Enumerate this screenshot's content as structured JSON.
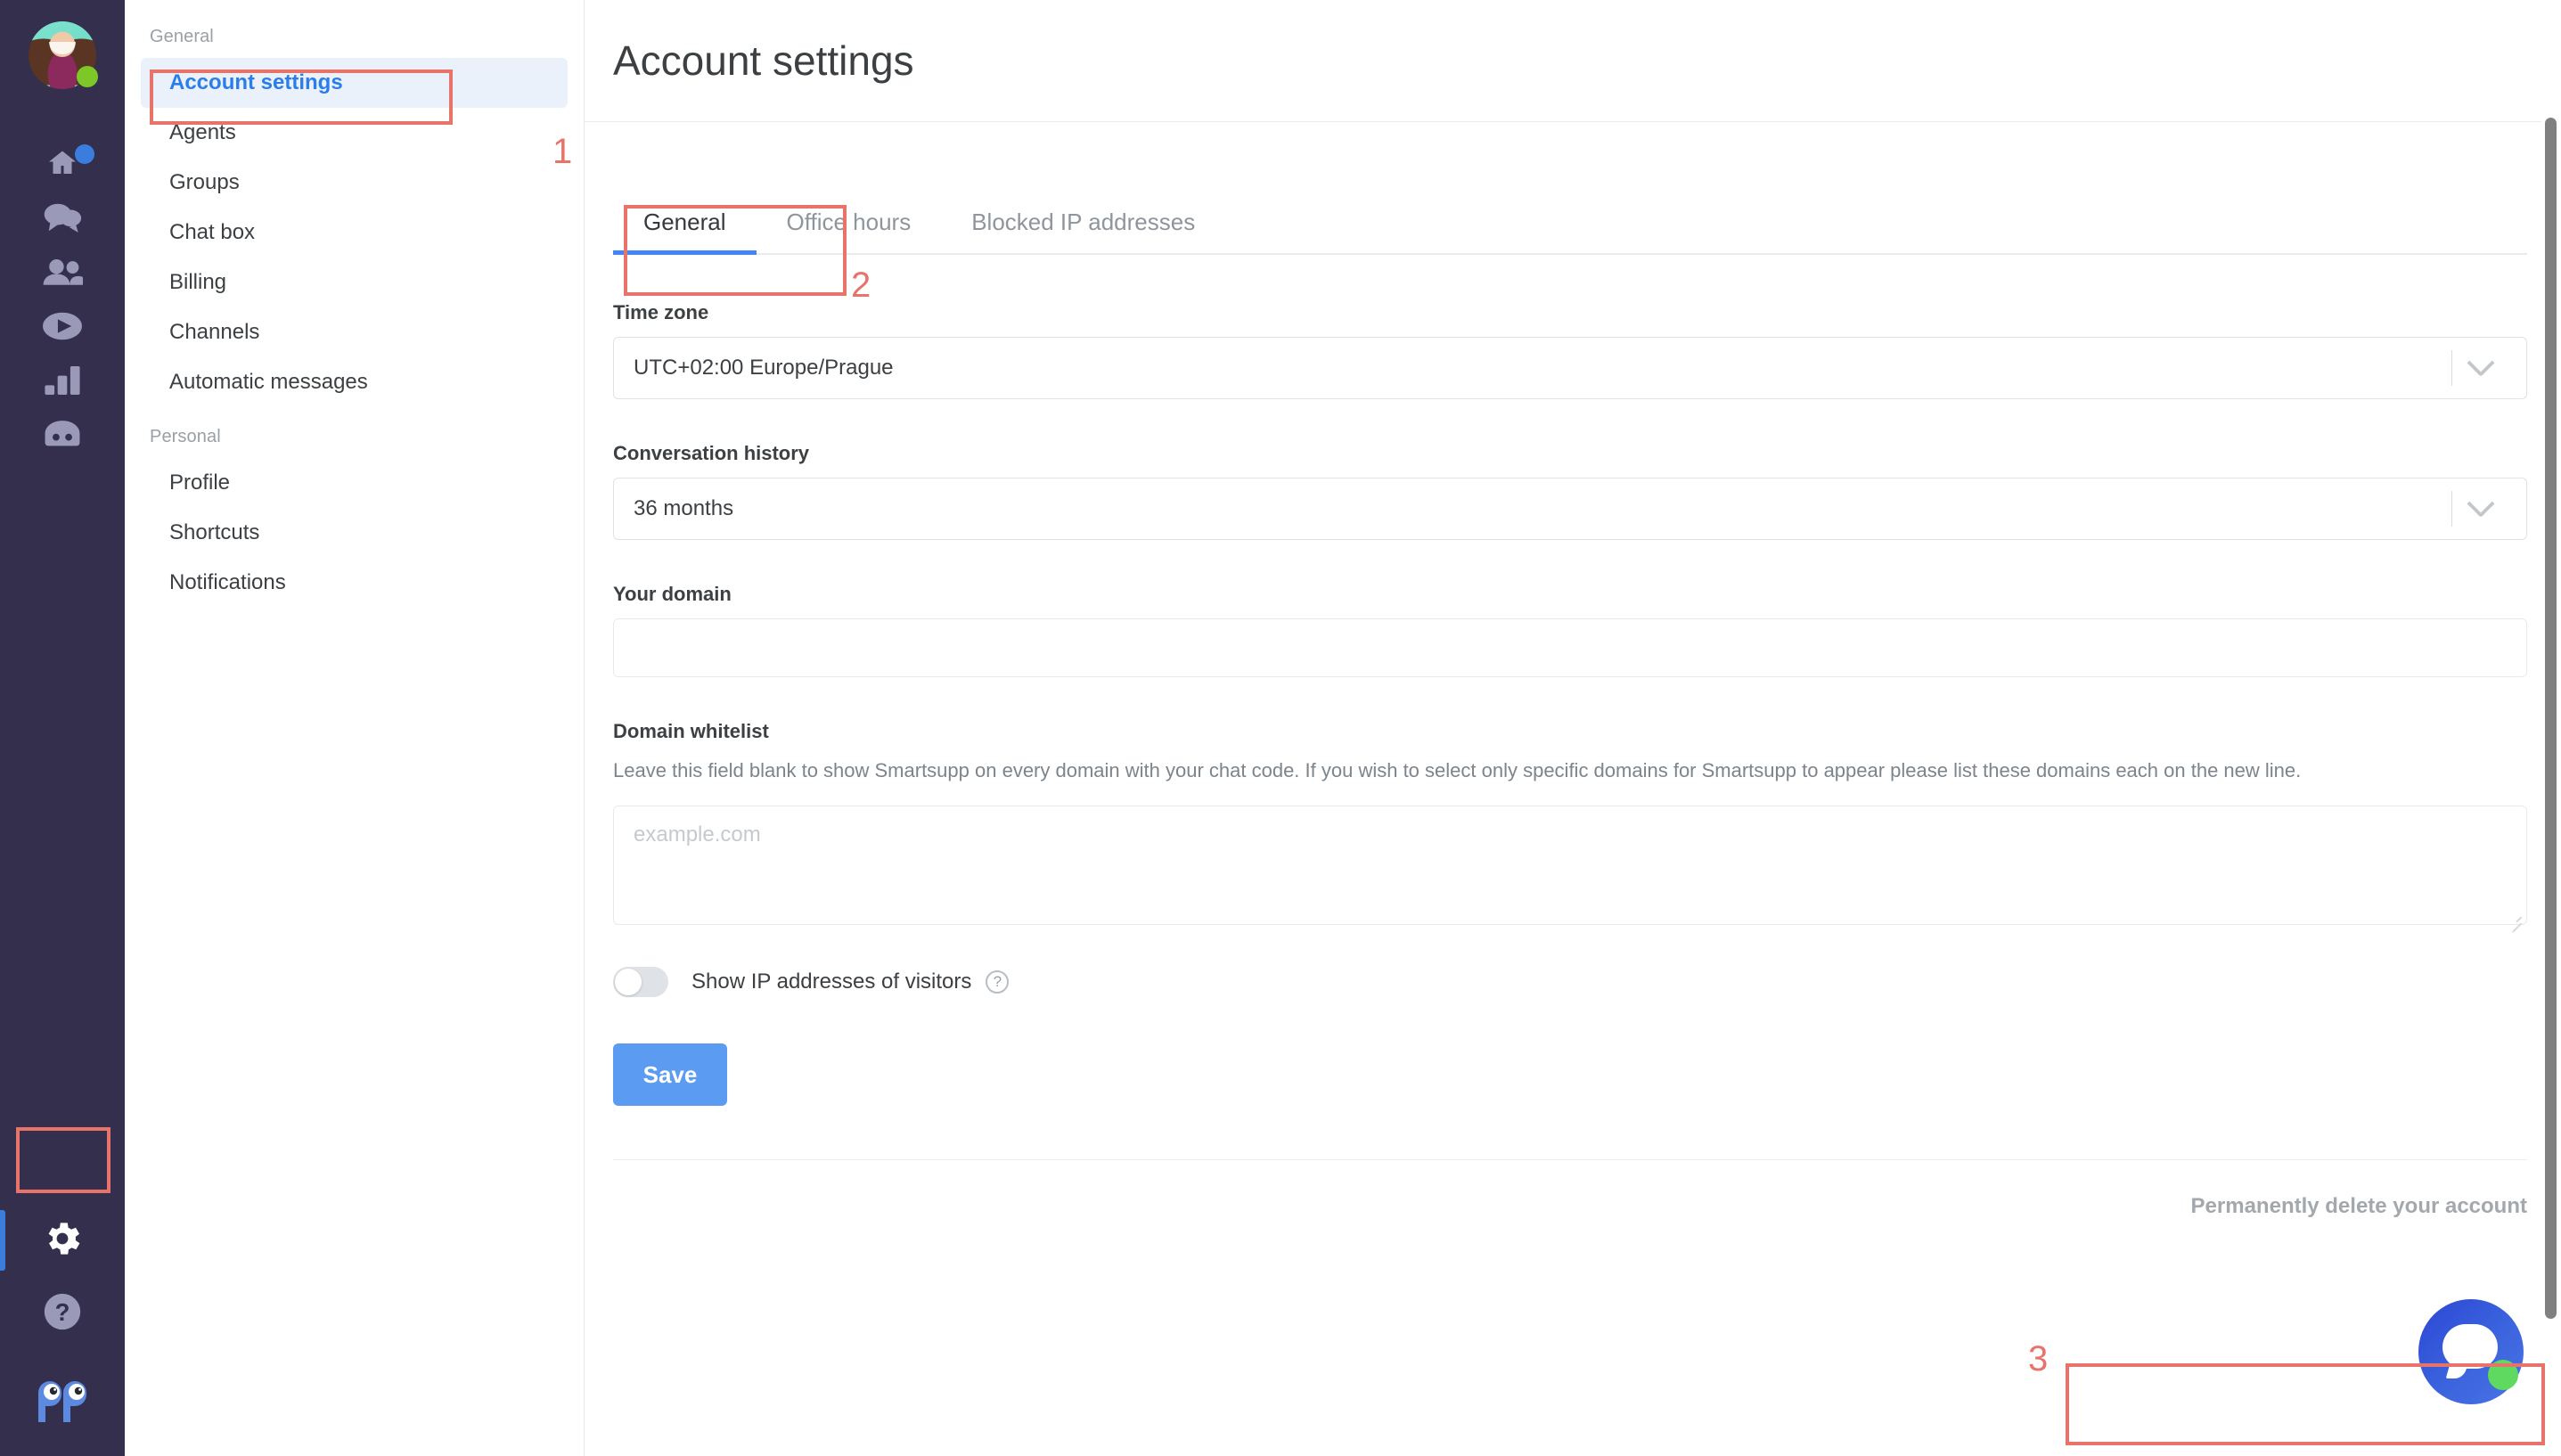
{
  "rail": {
    "avatar": {
      "name": "user-avatar",
      "status": "online"
    },
    "items": [
      {
        "icon": "home-icon",
        "name": "home",
        "badge": true
      },
      {
        "icon": "chat-icon",
        "name": "conversations",
        "badge": false
      },
      {
        "icon": "people-icon",
        "name": "visitors",
        "badge": false
      },
      {
        "icon": "play-icon",
        "name": "recordings",
        "badge": false
      },
      {
        "icon": "bar-chart-icon",
        "name": "statistics",
        "badge": false
      },
      {
        "icon": "robot-icon",
        "name": "chatbot",
        "badge": false
      }
    ],
    "bottom": [
      {
        "icon": "gear-icon",
        "name": "settings",
        "active": true
      },
      {
        "icon": "question-mark-icon",
        "name": "help",
        "active": false
      },
      {
        "icon": "smartsupp-logo-icon",
        "name": "brand-logo",
        "active": false
      }
    ],
    "colors": {
      "background": "#332f4d",
      "icon": "#9b99b8",
      "accent": "#3b7ddd",
      "status_online": "#7ec729"
    }
  },
  "sidebar": {
    "groups": [
      {
        "title": "General",
        "items": [
          {
            "label": "Account settings",
            "active": true
          },
          {
            "label": "Agents",
            "active": false
          },
          {
            "label": "Groups",
            "active": false
          },
          {
            "label": "Chat box",
            "active": false
          },
          {
            "label": "Billing",
            "active": false
          },
          {
            "label": "Channels",
            "active": false
          },
          {
            "label": "Automatic messages",
            "active": false
          }
        ]
      },
      {
        "title": "Personal",
        "items": [
          {
            "label": "Profile",
            "active": false
          },
          {
            "label": "Shortcuts",
            "active": false
          },
          {
            "label": "Notifications",
            "active": false
          }
        ]
      }
    ],
    "active_color": "#2b7de9",
    "active_background": "#eaf1fb"
  },
  "header": {
    "title": "Account settings"
  },
  "tabs": [
    {
      "label": "General",
      "active": true
    },
    {
      "label": "Office hours",
      "active": false
    },
    {
      "label": "Blocked IP addresses",
      "active": false
    }
  ],
  "form": {
    "timezone": {
      "label": "Time zone",
      "value": "UTC+02:00 Europe/Prague",
      "caret": "chevron-down-icon"
    },
    "conversation_history": {
      "label": "Conversation history",
      "value": "36 months",
      "caret": "chevron-down-icon"
    },
    "your_domain": {
      "label": "Your domain",
      "value": "",
      "placeholder": ""
    },
    "domain_whitelist": {
      "label": "Domain whitelist",
      "description": "Leave this field blank to show Smartsupp on every domain with your chat code. If you wish to select only specific domains for Smartsupp to appear please list these domains each on the new line.",
      "value": "",
      "placeholder": "example.com"
    },
    "show_ip_toggle": {
      "label": "Show IP addresses of visitors",
      "checked": false,
      "help_icon": "question-mark-circle-icon",
      "help_glyph": "?"
    },
    "save_label": "Save",
    "delete_account_label": "Permanently delete your account"
  },
  "chat_widget": {
    "name": "smartsupp-chat-launcher",
    "icon": "chat-bubble-icon",
    "status": "online",
    "color": "#2c46d4",
    "status_color": "#5fd95f"
  },
  "scrollbar": {
    "name": "page-scrollbar",
    "orientation": "vertical"
  },
  "annotations": [
    {
      "number": "1",
      "target": "sidebar-item-account-settings"
    },
    {
      "number": "2",
      "target": "tab-general"
    },
    {
      "number": "3",
      "target": "permanently-delete-account-link"
    }
  ],
  "colors": {
    "accent_blue": "#4285f4",
    "save_blue": "#5b9bf1",
    "annotation_red": "#e8736a",
    "text_primary": "#3c4043",
    "text_muted": "#8e959c"
  }
}
